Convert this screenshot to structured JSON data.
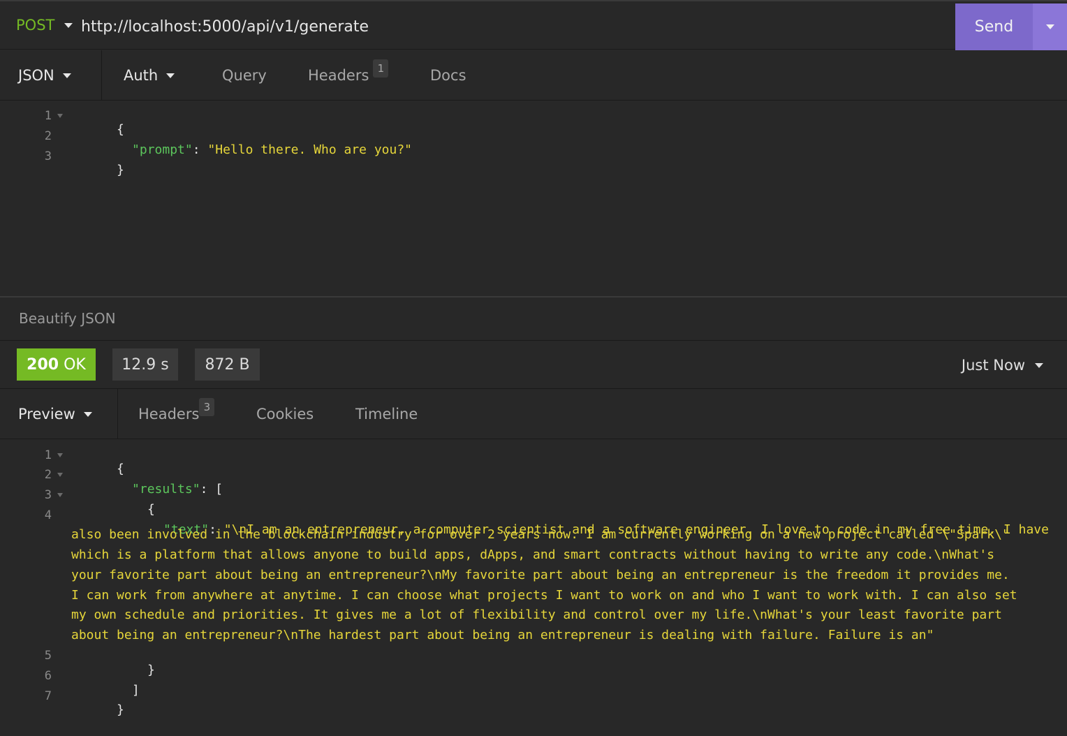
{
  "request": {
    "method": "POST",
    "url": "http://localhost:5000/api/v1/generate",
    "send_label": "Send"
  },
  "request_tabs": {
    "body_label": "JSON",
    "auth_label": "Auth",
    "query_label": "Query",
    "headers_label": "Headers",
    "headers_count": "1",
    "docs_label": "Docs"
  },
  "request_body": {
    "line_numbers": [
      "1",
      "2",
      "3"
    ],
    "open_brace": "{",
    "prompt_key": "\"prompt\"",
    "colon": ": ",
    "prompt_value": "\"Hello there. Who are you?\"",
    "close_brace": "}"
  },
  "beautify_label": "Beautify JSON",
  "status": {
    "code": "200",
    "text": "OK",
    "time": "12.9 s",
    "size": "872 B",
    "history_label": "Just Now"
  },
  "response_tabs": {
    "preview_label": "Preview",
    "headers_label": "Headers",
    "headers_count": "3",
    "cookies_label": "Cookies",
    "timeline_label": "Timeline"
  },
  "response_body": {
    "line_numbers": [
      "1",
      "2",
      "3",
      "4",
      "5",
      "6",
      "7"
    ],
    "open_brace": "{",
    "results_key": "\"results\"",
    "colon": ": ",
    "open_bracket": "[",
    "inner_open": "{",
    "text_key": "\"text\"",
    "text_lines": [
      "\"\\nI am an entrepreneur, a computer scientist and a software engineer. I love to code in my free time. I have",
      "also been involved in the blockchain industry for over 2 years now. I am currently working on a new project called \\\"Spark\\\"",
      "which is a platform that allows anyone to build apps, dApps, and smart contracts without having to write any code.\\nWhat's",
      "your favorite part about being an entrepreneur?\\nMy favorite part about being an entrepreneur is the freedom it provides me.",
      "I can work from anywhere at anytime. I can choose what projects I want to work on and who I want to work with. I can also set",
      "my own schedule and priorities. It gives me a lot of flexibility and control over my life.\\nWhat's your least favorite part",
      "about being an entrepreneur?\\nThe hardest part about being an entrepreneur is dealing with failure. Failure is an\""
    ],
    "inner_close": "}",
    "close_bracket": "]",
    "close_brace": "}"
  },
  "colors": {
    "background": "#282828",
    "method_green": "#75ba24",
    "send_purple": "#7d69cb",
    "json_key_green": "#5cc65c",
    "json_string_yellow": "#e6d63a"
  }
}
